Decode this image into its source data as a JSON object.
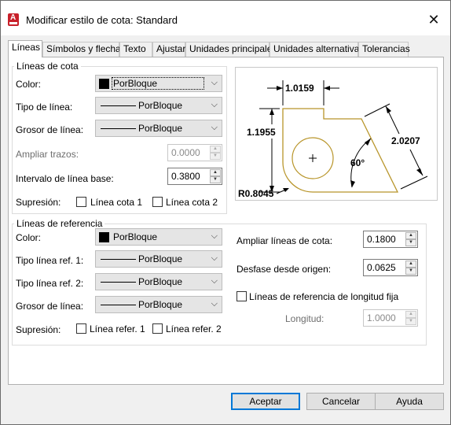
{
  "window": {
    "title": "Modificar estilo de cota: Standard",
    "close_label": "✕",
    "app_icon_letter": "A"
  },
  "tabs": [
    {
      "label": "Líneas"
    },
    {
      "label": "Símbolos y flechas"
    },
    {
      "label": "Texto"
    },
    {
      "label": "Ajustar"
    },
    {
      "label": "Unidades principales"
    },
    {
      "label": "Unidades alternativas"
    },
    {
      "label": "Tolerancias"
    }
  ],
  "dim_lines": {
    "legend": "Líneas de cota",
    "color_label": "Color:",
    "color_value": "PorBloque",
    "linetype_label": "Tipo de línea:",
    "linetype_value": "PorBloque",
    "lineweight_label": "Grosor de línea:",
    "lineweight_value": "PorBloque",
    "extend_label": "Ampliar trazos:",
    "extend_value": "0.0000",
    "baseline_label": "Intervalo de línea base:",
    "baseline_value": "0.3800",
    "suppress_label": "Supresión:",
    "suppress_1": "Línea cota 1",
    "suppress_2": "Línea cota 2"
  },
  "ext_lines": {
    "legend": "Líneas de referencia",
    "color_label": "Color:",
    "color_value": "PorBloque",
    "linetype1_label": "Tipo línea ref. 1:",
    "linetype1_value": "PorBloque",
    "linetype2_label": "Tipo línea ref. 2:",
    "linetype2_value": "PorBloque",
    "lineweight_label": "Grosor de línea:",
    "lineweight_value": "PorBloque",
    "suppress_label": "Supresión:",
    "suppress_1": "Línea refer. 1",
    "suppress_2": "Línea refer. 2",
    "extend_label": "Ampliar líneas de cota:",
    "extend_value": "0.1800",
    "offset_label": "Desfase desde origen:",
    "offset_value": "0.0625",
    "fixed_label": "Líneas de referencia de longitud fija",
    "length_label": "Longitud:",
    "length_value": "1.0000"
  },
  "preview": {
    "dim_top": "1.0159",
    "dim_left": "1.1955",
    "dim_right": "2.0207",
    "angle": "60°",
    "radius": "R0.8045"
  },
  "buttons": {
    "ok": "Aceptar",
    "cancel": "Cancelar",
    "help": "Ayuda"
  },
  "colors": {
    "accent": "#0078d7",
    "preview_shape": "#b8952a",
    "app_icon": "#c8202a"
  }
}
